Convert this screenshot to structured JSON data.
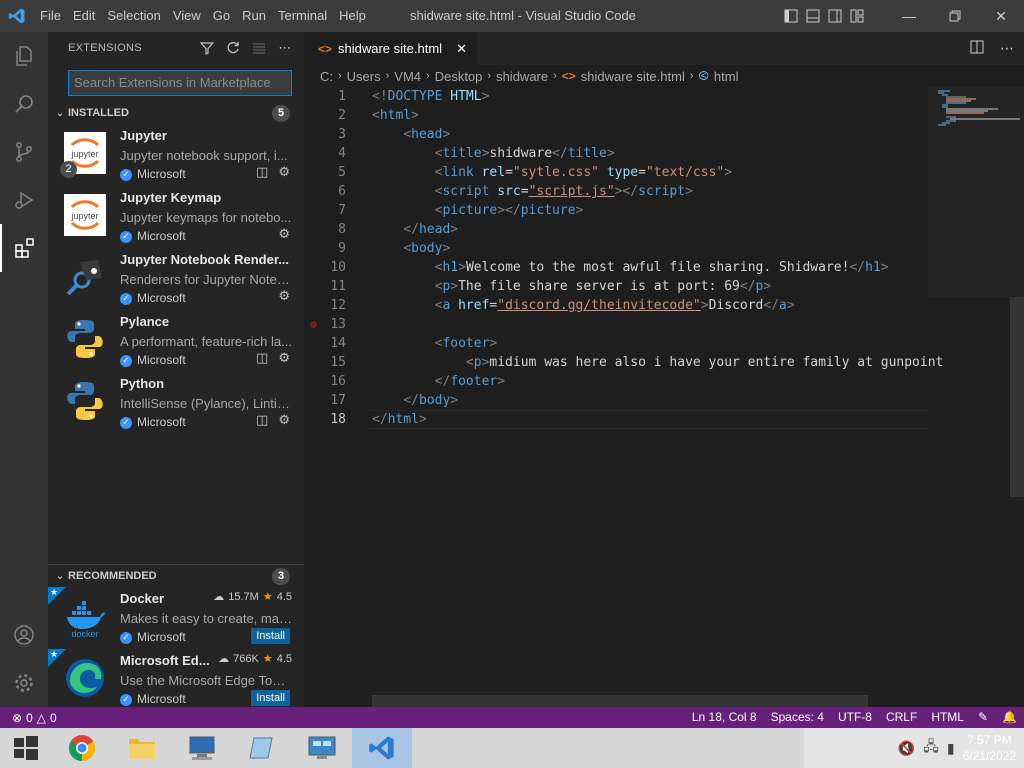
{
  "window": {
    "title": "shidware site.html - Visual Studio Code",
    "menu": [
      "File",
      "Edit",
      "Selection",
      "View",
      "Go",
      "Run",
      "Terminal",
      "Help"
    ]
  },
  "sidebar": {
    "title": "EXTENSIONS",
    "search_placeholder": "Search Extensions in Marketplace",
    "installed": {
      "label": "INSTALLED",
      "count": "5",
      "items": [
        {
          "name": "Jupyter",
          "desc": "Jupyter notebook support, i...",
          "publisher": "Microsoft",
          "icon": "jupyter-icon",
          "badge": "2"
        },
        {
          "name": "Jupyter Keymap",
          "desc": "Jupyter keymaps for notebo...",
          "publisher": "Microsoft",
          "icon": "jupyter-icon"
        },
        {
          "name": "Jupyter Notebook Render...",
          "desc": "Renderers for Jupyter Noteb...",
          "publisher": "Microsoft",
          "icon": "jupyter-renderer-icon"
        },
        {
          "name": "Pylance",
          "desc": "A performant, feature-rich la...",
          "publisher": "Microsoft",
          "icon": "python-icon"
        },
        {
          "name": "Python",
          "desc": "IntelliSense (Pylance), Lintin...",
          "publisher": "Microsoft",
          "icon": "python-icon"
        }
      ]
    },
    "recommended": {
      "label": "RECOMMENDED",
      "count": "3",
      "items": [
        {
          "name": "Docker",
          "desc": "Makes it easy to create, man...",
          "publisher": "Microsoft",
          "downloads": "15.7M",
          "rating": "4.5",
          "install": "Install",
          "icon": "docker-icon"
        },
        {
          "name": "Microsoft Ed...",
          "desc": "Use the Microsoft Edge Tool...",
          "publisher": "Microsoft",
          "downloads": "766K",
          "rating": "4.5",
          "install": "Install",
          "icon": "edge-icon"
        }
      ]
    }
  },
  "editor": {
    "tab": "shidware site.html",
    "breadcrumb": [
      "C:",
      "Users",
      "VM4",
      "Desktop",
      "shidware",
      "shidware site.html",
      "html"
    ],
    "code": {
      "l9_text": "Welcome to the most awful file sharing. Shidware!",
      "l10_text": "The file share server is at port: 69",
      "l12_href": "\"discord.gg/theinvitecode\"",
      "l12_text": "Discord",
      "l15_text": "midium was here also i have your entire family at gunpoint",
      "title_text": "shidware",
      "rel": "\"sytle.css\"",
      "type": "\"text/css\"",
      "src": "\"script.js\""
    }
  },
  "status": {
    "errors": "0",
    "warnings": "0",
    "position": "Ln 18, Col 8",
    "spaces": "Spaces: 4",
    "encoding": "UTF-8",
    "eol": "CRLF",
    "language": "HTML"
  },
  "taskbar": {
    "time": "7:57 PM",
    "date": "6/21/2022"
  },
  "colors": {
    "statusbar": "#68217a",
    "accent": "#007acc"
  }
}
